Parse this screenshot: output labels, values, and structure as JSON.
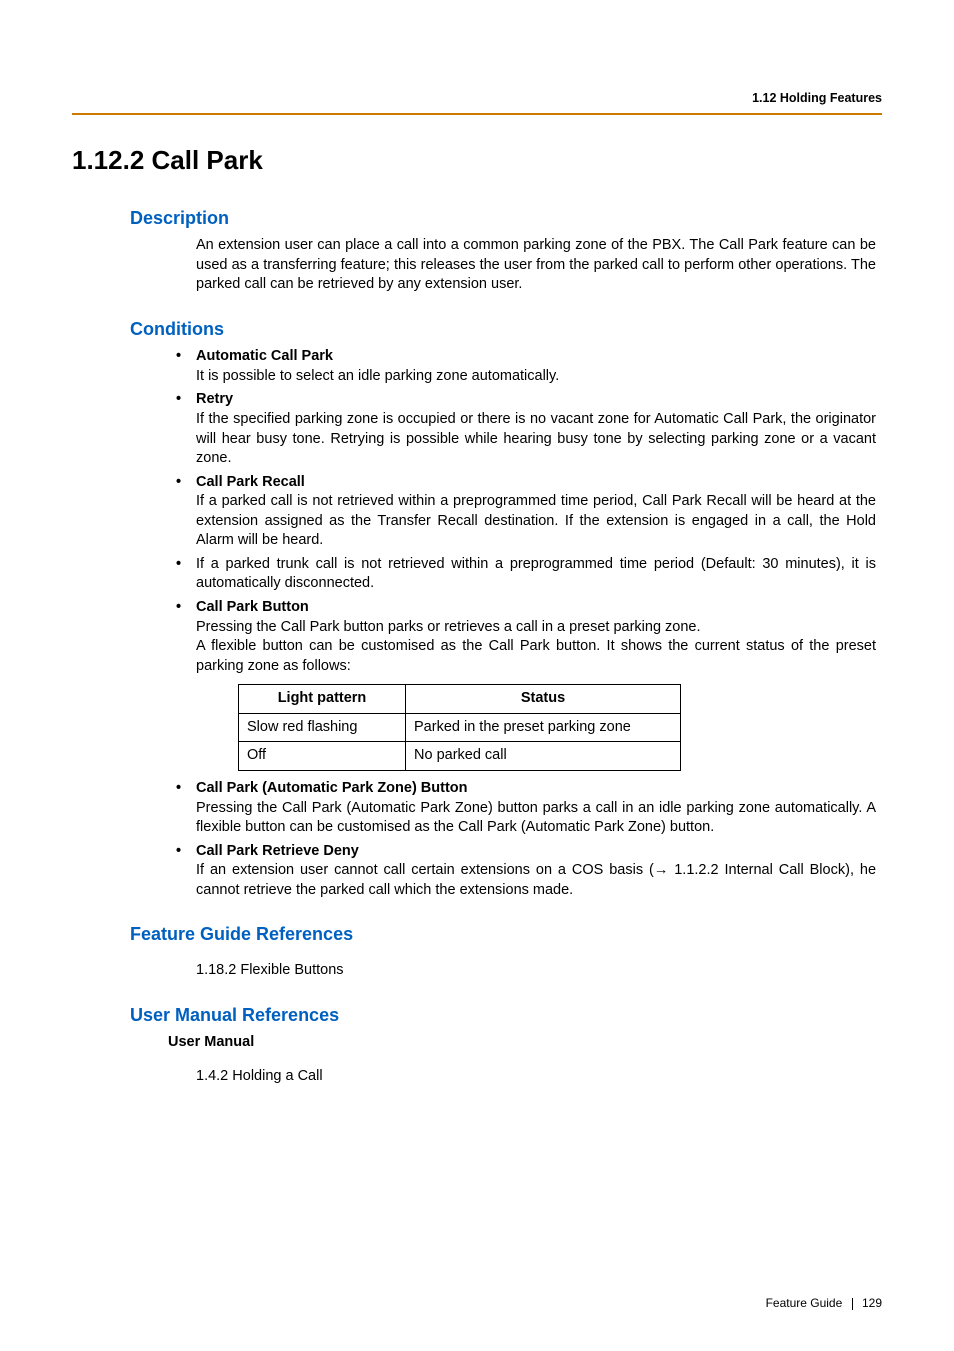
{
  "running_header": "1.12 Holding Features",
  "title": "1.12.2  Call Park",
  "description_heading": "Description",
  "description_text": "An extension user can place a call into a common parking zone of the PBX. The Call Park feature can be used as a transferring feature; this releases the user from the parked call to perform other operations. The parked call can be retrieved by any extension user.",
  "conditions_heading": "Conditions",
  "conditions": [
    {
      "title": "Automatic Call Park",
      "text": "It is possible to select an idle parking zone automatically."
    },
    {
      "title": "Retry",
      "text": "If the specified parking zone is occupied or there is no vacant zone for Automatic Call Park, the originator will hear busy tone. Retrying is possible while hearing busy tone by selecting parking zone or a vacant zone."
    },
    {
      "title": "Call Park Recall",
      "text": "If a parked call is not retrieved within a preprogrammed time period, Call Park Recall will be heard at the extension assigned as the Transfer Recall destination. If the extension is engaged in a call, the Hold Alarm will be heard."
    },
    {
      "title": "",
      "text": "If a parked trunk call is not retrieved within a preprogrammed time period (Default: 30 minutes), it is automatically disconnected."
    },
    {
      "title": "Call Park Button",
      "text": "Pressing the Call Park button parks or retrieves a call in a preset parking zone.\nA flexible button can be customised as the Call Park button. It shows the current status of the preset parking zone as follows:"
    }
  ],
  "table": {
    "headers": [
      "Light pattern",
      "Status"
    ],
    "rows": [
      [
        "Slow red flashing",
        "Parked in the preset parking zone"
      ],
      [
        "Off",
        "No parked call"
      ]
    ]
  },
  "conditions2": [
    {
      "title": "Call Park (Automatic Park Zone) Button",
      "text": "Pressing the Call Park (Automatic Park Zone) button parks a call in an idle parking zone automatically. A flexible button can be customised as the Call Park (Automatic Park Zone) button."
    },
    {
      "title": "Call Park Retrieve Deny",
      "text_before": "If an extension user cannot call certain extensions on a COS basis (",
      "xref": " 1.1.2.2 Internal Call Block",
      "text_after": "), he cannot retrieve the parked call which the extensions made."
    }
  ],
  "feature_guide_heading": "Feature Guide References",
  "feature_guide_ref": "1.18.2 Flexible Buttons",
  "user_manual_heading": "User Manual References",
  "user_manual_sub": "User Manual",
  "user_manual_ref": "1.4.2 Holding a Call",
  "footer_label": "Feature Guide",
  "footer_page": "129"
}
